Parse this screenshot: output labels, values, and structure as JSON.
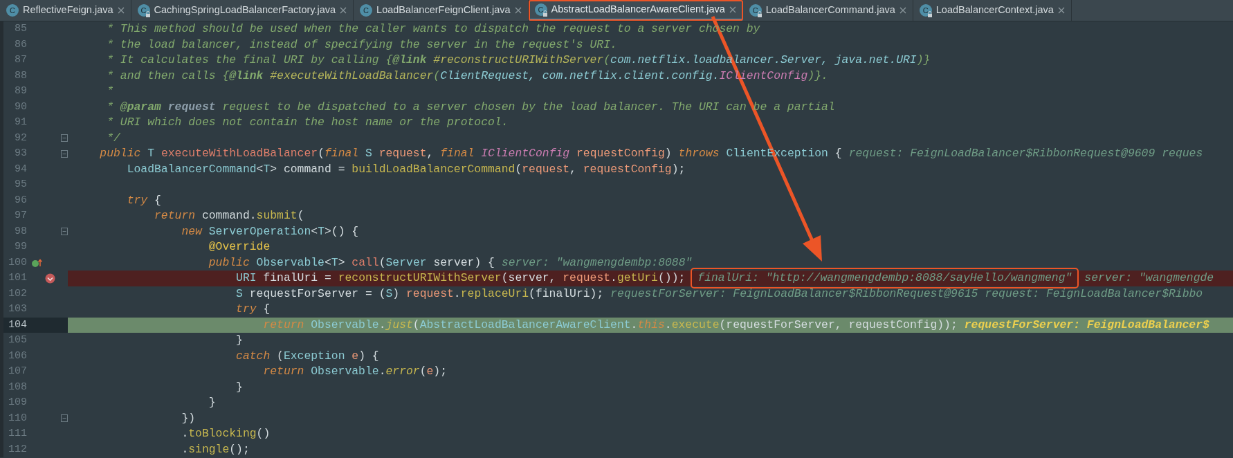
{
  "tabs": [
    {
      "icon": "C",
      "label": "ReflectiveFeign.java",
      "locked": false,
      "selected": false,
      "highlighted": false
    },
    {
      "icon": "C",
      "label": "CachingSpringLoadBalancerFactory.java",
      "locked": true,
      "selected": false,
      "highlighted": false
    },
    {
      "icon": "C",
      "label": "LoadBalancerFeignClient.java",
      "locked": false,
      "selected": false,
      "highlighted": false
    },
    {
      "icon": "C",
      "label": "AbstractLoadBalancerAwareClient.java",
      "locked": true,
      "selected": true,
      "highlighted": true
    },
    {
      "icon": "C",
      "label": "LoadBalancerCommand.java",
      "locked": true,
      "selected": false,
      "highlighted": false
    },
    {
      "icon": "C",
      "label": "LoadBalancerContext.java",
      "locked": true,
      "selected": false,
      "highlighted": false
    }
  ],
  "lines": [
    {
      "number": "85",
      "fold": false,
      "breakpoint": false,
      "current": false,
      "tokens": [
        {
          "text": "     * This method should be used when the caller wants to dispatch the request to a server chosen by",
          "kind": "comment"
        }
      ]
    },
    {
      "number": "86",
      "fold": false,
      "breakpoint": false,
      "current": false,
      "tokens": [
        {
          "text": "     * the load balancer, instead of specifying the server in the request's URI.",
          "kind": "comment"
        }
      ]
    },
    {
      "number": "87",
      "fold": false,
      "breakpoint": false,
      "current": false,
      "tokens": [
        {
          "text": "     * It calculates the final URI by calling {",
          "kind": "comment"
        },
        {
          "text": "@link ",
          "kind": "doctag"
        },
        {
          "text": "#reconstructURIWithServer",
          "kind": "docref"
        },
        {
          "text": "(",
          "kind": "comment"
        },
        {
          "text": "com.netflix.loadbalancer.Server, java.net.URI",
          "kind": "doctype"
        },
        {
          "text": ")}",
          "kind": "comment"
        }
      ]
    },
    {
      "number": "88",
      "fold": false,
      "breakpoint": false,
      "current": false,
      "tokens": [
        {
          "text": "     * and then calls {",
          "kind": "comment"
        },
        {
          "text": "@link ",
          "kind": "doctag"
        },
        {
          "text": "#executeWithLoadBalancer",
          "kind": "docref"
        },
        {
          "text": "(",
          "kind": "comment"
        },
        {
          "text": "ClientRequest, com.netflix.client.config.",
          "kind": "doctype"
        },
        {
          "text": "IClientConfig",
          "kind": "interface"
        },
        {
          "text": ")}.",
          "kind": "comment"
        }
      ]
    },
    {
      "number": "89",
      "fold": false,
      "breakpoint": false,
      "current": false,
      "tokens": [
        {
          "text": "     *",
          "kind": "comment"
        }
      ]
    },
    {
      "number": "90",
      "fold": false,
      "breakpoint": false,
      "current": false,
      "tokens": [
        {
          "text": "     * ",
          "kind": "comment"
        },
        {
          "text": "@param ",
          "kind": "doctag"
        },
        {
          "text": "request",
          "kind": "docparam"
        },
        {
          "text": " request to be dispatched to a server chosen by the load balancer. The URI can be a partial",
          "kind": "comment"
        }
      ]
    },
    {
      "number": "91",
      "fold": false,
      "breakpoint": false,
      "current": false,
      "tokens": [
        {
          "text": "     * URI which does not contain the host name or the protocol.",
          "kind": "comment"
        }
      ]
    },
    {
      "number": "92",
      "fold": true,
      "breakpoint": false,
      "current": false,
      "tokens": [
        {
          "text": "     */",
          "kind": "comment"
        }
      ]
    },
    {
      "number": "93",
      "fold": true,
      "breakpoint": false,
      "current": false,
      "tokens": [
        {
          "text": "    public ",
          "kind": "keyword"
        },
        {
          "text": "T ",
          "kind": "type"
        },
        {
          "text": "executeWithLoadBalancer",
          "kind": "declaration"
        },
        {
          "text": "(",
          "kind": "plain"
        },
        {
          "text": "final ",
          "kind": "keyword"
        },
        {
          "text": "S ",
          "kind": "type"
        },
        {
          "text": "request",
          "kind": "param"
        },
        {
          "text": ", ",
          "kind": "plain"
        },
        {
          "text": "final ",
          "kind": "keyword"
        },
        {
          "text": "IClientConfig ",
          "kind": "interface"
        },
        {
          "text": "requestConfig",
          "kind": "param"
        },
        {
          "text": ") ",
          "kind": "plain"
        },
        {
          "text": "throws ",
          "kind": "keyword"
        },
        {
          "text": "ClientException",
          "kind": "type"
        },
        {
          "text": " {",
          "kind": "plain"
        }
      ],
      "hints": [
        {
          "text": "request: FeignLoadBalancer$RibbonRequest@9609",
          "highlighted": false
        },
        {
          "text": "reques",
          "highlighted": false
        }
      ]
    },
    {
      "number": "94",
      "fold": false,
      "breakpoint": false,
      "current": false,
      "tokens": [
        {
          "text": "        LoadBalancerCommand",
          "kind": "type"
        },
        {
          "text": "<",
          "kind": "plain"
        },
        {
          "text": "T",
          "kind": "type"
        },
        {
          "text": "> command = ",
          "kind": "plain"
        },
        {
          "text": "buildLoadBalancerCommand",
          "kind": "method"
        },
        {
          "text": "(",
          "kind": "plain"
        },
        {
          "text": "request",
          "kind": "param"
        },
        {
          "text": ", ",
          "kind": "plain"
        },
        {
          "text": "requestConfig",
          "kind": "param"
        },
        {
          "text": ");",
          "kind": "plain"
        }
      ]
    },
    {
      "number": "95",
      "fold": false,
      "breakpoint": false,
      "current": false
    },
    {
      "number": "96",
      "fold": false,
      "breakpoint": false,
      "current": false,
      "tokens": [
        {
          "text": "        try",
          "kind": "keyword"
        },
        {
          "text": " {",
          "kind": "plain"
        }
      ]
    },
    {
      "number": "97",
      "fold": false,
      "breakpoint": false,
      "current": false,
      "tokens": [
        {
          "text": "            return",
          "kind": "keyword"
        },
        {
          "text": " command.",
          "kind": "plain"
        },
        {
          "text": "submit",
          "kind": "method"
        },
        {
          "text": "(",
          "kind": "plain"
        }
      ]
    },
    {
      "number": "98",
      "fold": true,
      "breakpoint": false,
      "current": false,
      "tokens": [
        {
          "text": "                new ",
          "kind": "keyword"
        },
        {
          "text": "ServerOperation",
          "kind": "type"
        },
        {
          "text": "<",
          "kind": "plain"
        },
        {
          "text": "T",
          "kind": "type"
        },
        {
          "text": ">() {",
          "kind": "plain"
        }
      ]
    },
    {
      "number": "99",
      "fold": false,
      "breakpoint": false,
      "current": false,
      "tokens": [
        {
          "text": "                    @Override",
          "kind": "annotation"
        }
      ]
    },
    {
      "number": "100",
      "fold": false,
      "breakpoint": false,
      "current": false,
      "override": true,
      "tokens": [
        {
          "text": "                    public ",
          "kind": "keyword"
        },
        {
          "text": "Observable",
          "kind": "type"
        },
        {
          "text": "<",
          "kind": "plain"
        },
        {
          "text": "T",
          "kind": "type"
        },
        {
          "text": "> ",
          "kind": "plain"
        },
        {
          "text": "call",
          "kind": "declaration"
        },
        {
          "text": "(",
          "kind": "plain"
        },
        {
          "text": "Server",
          "kind": "type"
        },
        {
          "text": " server) {",
          "kind": "plain"
        }
      ],
      "hints": [
        {
          "text": "server: \"wangmengdembp:8088\"",
          "highlighted": false
        }
      ]
    },
    {
      "number": "101",
      "fold": false,
      "breakpoint": true,
      "current": false,
      "tokens": [
        {
          "text": "                        URI",
          "kind": "type"
        },
        {
          "text": " finalUri = ",
          "kind": "plain"
        },
        {
          "text": "reconstructURIWithServer",
          "kind": "method"
        },
        {
          "text": "(server, ",
          "kind": "plain"
        },
        {
          "text": "request",
          "kind": "param"
        },
        {
          "text": ".",
          "kind": "plain"
        },
        {
          "text": "getUri",
          "kind": "method"
        },
        {
          "text": "());",
          "kind": "plain"
        }
      ],
      "hints": [
        {
          "text": "finalUri: \"http://wangmengdembp:8088/sayHello/wangmeng\"",
          "highlighted": true
        },
        {
          "text": "server: \"wangmengde",
          "highlighted": false
        }
      ]
    },
    {
      "number": "102",
      "fold": false,
      "breakpoint": false,
      "current": false,
      "tokens": [
        {
          "text": "                        S",
          "kind": "type"
        },
        {
          "text": " requestForServer = (",
          "kind": "plain"
        },
        {
          "text": "S",
          "kind": "type"
        },
        {
          "text": ") ",
          "kind": "plain"
        },
        {
          "text": "request",
          "kind": "param"
        },
        {
          "text": ".",
          "kind": "plain"
        },
        {
          "text": "replaceUri",
          "kind": "method"
        },
        {
          "text": "(finalUri);",
          "kind": "plain"
        }
      ],
      "hints": [
        {
          "text": "requestForServer: FeignLoadBalancer$RibbonRequest@9615",
          "highlighted": false
        },
        {
          "text": "request: FeignLoadBalancer$Ribbo",
          "highlighted": false
        }
      ]
    },
    {
      "number": "103",
      "fold": false,
      "breakpoint": false,
      "current": false,
      "tokens": [
        {
          "text": "                        try",
          "kind": "keyword"
        },
        {
          "text": " {",
          "kind": "plain"
        }
      ]
    },
    {
      "number": "104",
      "fold": false,
      "breakpoint": false,
      "current": true,
      "tokens": [
        {
          "text": "                            return ",
          "kind": "keyword"
        },
        {
          "text": "Observable",
          "kind": "type"
        },
        {
          "text": ".",
          "kind": "plain"
        },
        {
          "text": "just",
          "kind": "static"
        },
        {
          "text": "(",
          "kind": "plain"
        },
        {
          "text": "AbstractLoadBalancerAwareClient",
          "kind": "type"
        },
        {
          "text": ".",
          "kind": "plain"
        },
        {
          "text": "this",
          "kind": "keyword"
        },
        {
          "text": ".",
          "kind": "plain"
        },
        {
          "text": "execute",
          "kind": "method"
        },
        {
          "text": "(requestForServer, requestConfig));",
          "kind": "plain"
        }
      ],
      "hints": [
        {
          "text": "requestForServer: FeignLoadBalancer$",
          "highlighted": false
        }
      ]
    },
    {
      "number": "105",
      "fold": false,
      "breakpoint": false,
      "current": false,
      "tokens": [
        {
          "text": "                        }",
          "kind": "plain"
        }
      ]
    },
    {
      "number": "106",
      "fold": false,
      "breakpoint": false,
      "current": false,
      "tokens": [
        {
          "text": "                        catch",
          "kind": "keyword"
        },
        {
          "text": " (",
          "kind": "plain"
        },
        {
          "text": "Exception ",
          "kind": "type"
        },
        {
          "text": "e",
          "kind": "param"
        },
        {
          "text": ") {",
          "kind": "plain"
        }
      ]
    },
    {
      "number": "107",
      "fold": false,
      "breakpoint": false,
      "current": false,
      "tokens": [
        {
          "text": "                            return ",
          "kind": "keyword"
        },
        {
          "text": "Observable",
          "kind": "type"
        },
        {
          "text": ".",
          "kind": "plain"
        },
        {
          "text": "error",
          "kind": "static"
        },
        {
          "text": "(",
          "kind": "plain"
        },
        {
          "text": "e",
          "kind": "param"
        },
        {
          "text": ");",
          "kind": "plain"
        }
      ]
    },
    {
      "number": "108",
      "fold": false,
      "breakpoint": false,
      "current": false,
      "tokens": [
        {
          "text": "                        }",
          "kind": "plain"
        }
      ]
    },
    {
      "number": "109",
      "fold": false,
      "breakpoint": false,
      "current": false,
      "tokens": [
        {
          "text": "                    }",
          "kind": "plain"
        }
      ]
    },
    {
      "number": "110",
      "fold": true,
      "breakpoint": false,
      "current": false,
      "tokens": [
        {
          "text": "                })",
          "kind": "plain"
        }
      ]
    },
    {
      "number": "111",
      "fold": false,
      "breakpoint": false,
      "current": false,
      "tokens": [
        {
          "text": "                .",
          "kind": "plain"
        },
        {
          "text": "toBlocking",
          "kind": "method"
        },
        {
          "text": "()",
          "kind": "plain"
        }
      ]
    },
    {
      "number": "112",
      "fold": false,
      "breakpoint": false,
      "current": false,
      "tokens": [
        {
          "text": "                .",
          "kind": "plain"
        },
        {
          "text": "single",
          "kind": "method"
        },
        {
          "text": "();",
          "kind": "plain"
        }
      ]
    }
  ]
}
